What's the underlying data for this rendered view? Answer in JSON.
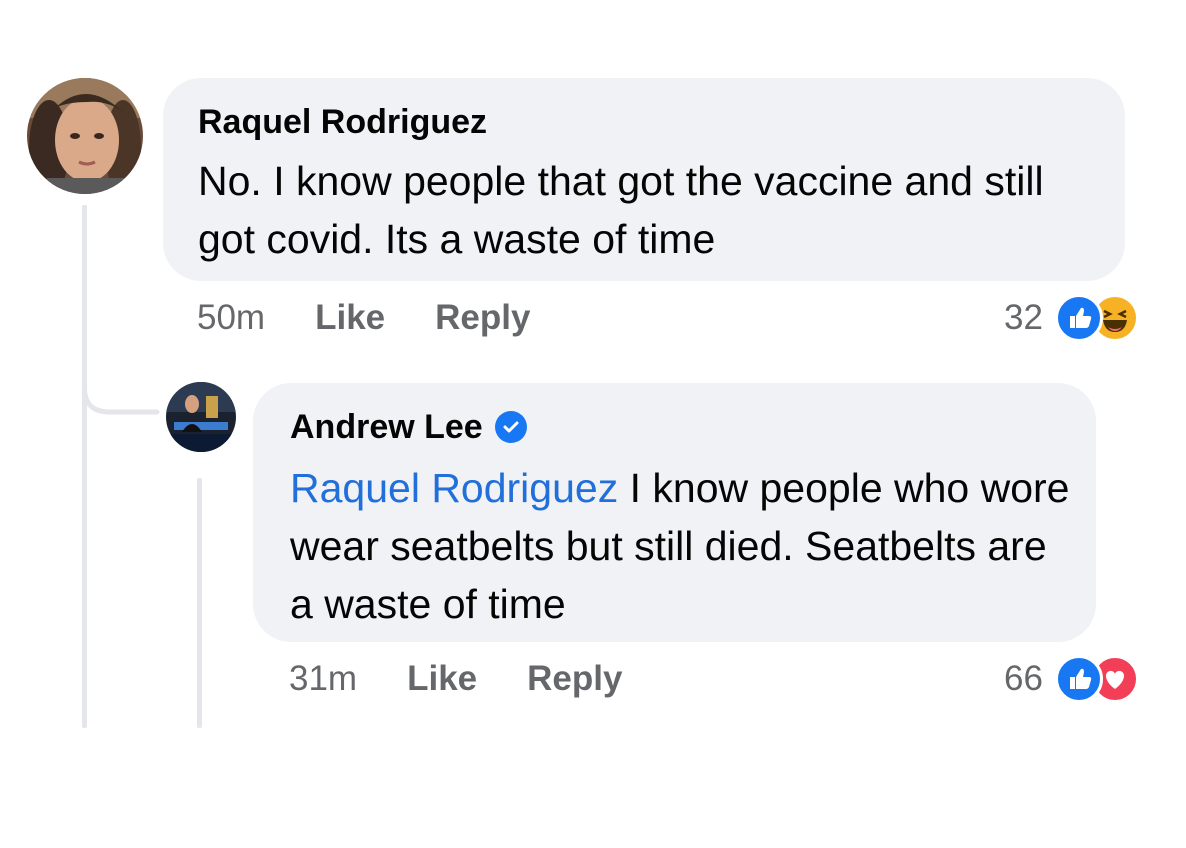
{
  "comment": {
    "author": "Raquel Rodriguez",
    "text": "No. I know people that got the vaccine and still got covid. Its a waste of time",
    "time": "50m",
    "like_label": "Like",
    "reply_label": "Reply",
    "reaction_count": "32",
    "reaction_icons": [
      "like-icon",
      "haha-icon"
    ]
  },
  "reply": {
    "author": "Andrew Lee",
    "verified": true,
    "mention": "Raquel Rodriguez",
    "text": "I know people who wore wear seatbelts but still died. Seatbelts are a waste of time",
    "time": "31m",
    "like_label": "Like",
    "reply_label": "Reply",
    "reaction_count": "66",
    "reaction_icons": [
      "like-icon",
      "love-icon"
    ]
  },
  "colors": {
    "bubble": "#f0f2f5",
    "meta": "#65676b",
    "mention": "#216fdb",
    "like": "#1877f2",
    "love": "#f33e58",
    "haha": "#f7b125"
  }
}
